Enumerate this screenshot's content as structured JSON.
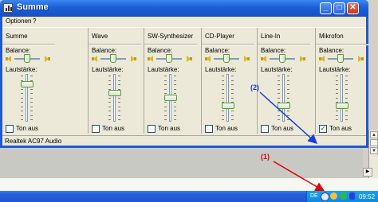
{
  "window": {
    "title": "Summe",
    "menu": [
      "Optionen",
      "?"
    ],
    "status": "Realtek AC97 Audio"
  },
  "labels": {
    "balance": "Balance:",
    "volume": "Lautstärke:",
    "mute": "Ton aus"
  },
  "channels": [
    {
      "name": "Summe",
      "balance": 0.5,
      "volume": 0.82,
      "muted": false
    },
    {
      "name": "Wave",
      "balance": 0.5,
      "volume": 0.62,
      "muted": false
    },
    {
      "name": "SW-Synthesizer",
      "balance": 0.5,
      "volume": 0.5,
      "muted": false
    },
    {
      "name": "CD-Player",
      "balance": 0.5,
      "volume": 0.3,
      "muted": false
    },
    {
      "name": "Line-In",
      "balance": 0.5,
      "volume": 0.3,
      "muted": false
    },
    {
      "name": "Mikrofon",
      "balance": 0.5,
      "volume": 0.3,
      "muted": true
    }
  ],
  "annotations": {
    "one": "(1)",
    "two": "(2)"
  },
  "taskbar": {
    "lang": "DE",
    "clock": "09:52"
  },
  "colors": {
    "annotation_red": "#e00000",
    "annotation_blue": "#1a3cd8",
    "title_bar": "#1d5fd6"
  }
}
